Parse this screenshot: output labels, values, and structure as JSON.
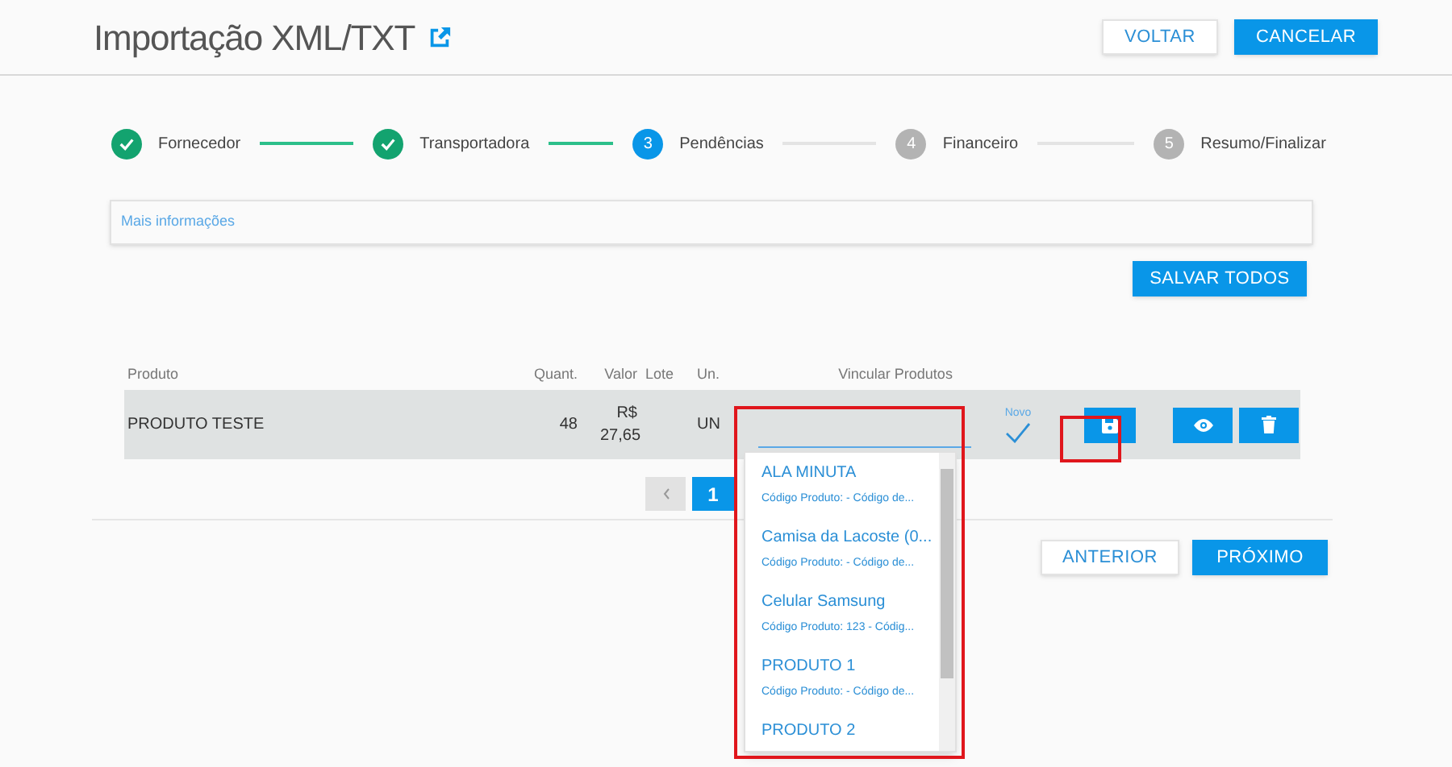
{
  "header": {
    "title": "Importação XML/TXT",
    "buttons": [
      {
        "label": "VOLTAR",
        "kind": "secondary"
      },
      {
        "label": "CANCELAR",
        "kind": "primary"
      }
    ]
  },
  "steps": [
    {
      "label": "Fornecedor",
      "completed": true,
      "selected": false
    },
    {
      "label": "Transportadora",
      "completed": true,
      "selected": false
    },
    {
      "number": "3",
      "label": "Pendências",
      "completed": false,
      "selected": true
    },
    {
      "number": "4",
      "label": "Financeiro",
      "completed": false,
      "selected": false
    },
    {
      "number": "5",
      "label": "Resumo/Finalizar",
      "completed": false,
      "selected": false
    }
  ],
  "info_link": "Mais informações",
  "save_all_button": "SALVAR TODOS",
  "table": {
    "columns": [
      "Produto",
      "Quant.",
      "Valor",
      "Lote",
      "Un.",
      "Vincular Produtos"
    ],
    "rows": [
      {
        "product": "PRODUTO TESTE",
        "quantity": "48",
        "value": "R$ 27,65",
        "unit": "UN",
        "status": "Novo"
      }
    ]
  },
  "dropdown": {
    "options": [
      {
        "title": "ALA MINUTA",
        "subtitle": "Código Produto: - Código de..."
      },
      {
        "title": "Camisa da Lacoste (0...",
        "subtitle": "Código Produto: - Código de..."
      },
      {
        "title": "Celular Samsung",
        "subtitle": "Código Produto: 123 - Códig..."
      },
      {
        "title": "PRODUTO 1",
        "subtitle": "Código Produto: - Código de..."
      },
      {
        "title": "PRODUTO 2"
      }
    ]
  },
  "pagination": {
    "pages": [
      {
        "label": "1",
        "selected": true
      }
    ]
  },
  "footer_buttons": [
    {
      "label": "ANTERIOR",
      "kind": "secondary"
    },
    {
      "label": "PRÓXIMO",
      "kind": "primary"
    }
  ]
}
